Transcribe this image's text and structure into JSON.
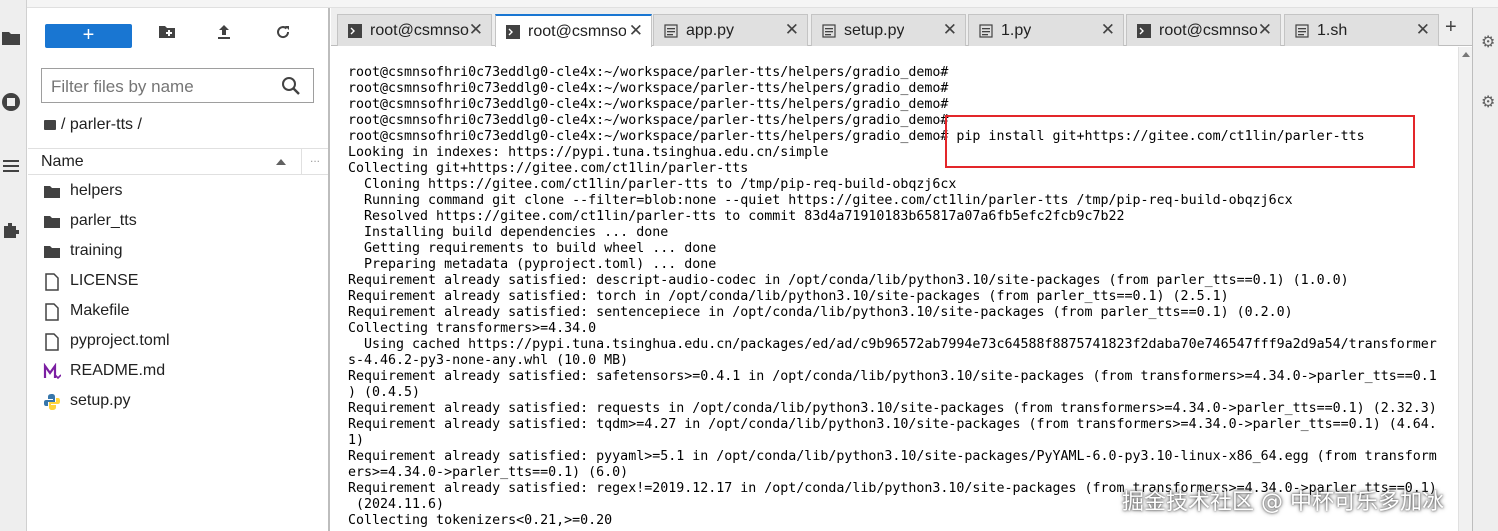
{
  "file_browser": {
    "new_button_label": "+",
    "filter_placeholder": "Filter files by name",
    "breadcrumb": "/ parler-tts /",
    "column_name": "Name",
    "more_columns": "...",
    "files": [
      {
        "name": "helpers",
        "icon": "folder-icon"
      },
      {
        "name": "parler_tts",
        "icon": "folder-icon"
      },
      {
        "name": "training",
        "icon": "folder-icon"
      },
      {
        "name": "LICENSE",
        "icon": "file-icon"
      },
      {
        "name": "Makefile",
        "icon": "file-icon"
      },
      {
        "name": "pyproject.toml",
        "icon": "file-icon"
      },
      {
        "name": "README.md",
        "icon": "markdown-icon"
      },
      {
        "name": "setup.py",
        "icon": "python-icon"
      }
    ]
  },
  "tabs": [
    {
      "label": "root@csmnso",
      "icon": "terminal-icon",
      "active": false
    },
    {
      "label": "root@csmnso",
      "icon": "terminal-icon",
      "active": true
    },
    {
      "label": "app.py",
      "icon": "editor-icon",
      "active": false
    },
    {
      "label": "setup.py",
      "icon": "editor-icon",
      "active": false
    },
    {
      "label": "1.py",
      "icon": "editor-icon",
      "active": false
    },
    {
      "label": "root@csmnso",
      "icon": "terminal-icon",
      "active": false
    },
    {
      "label": "1.sh",
      "icon": "editor-icon",
      "active": false
    }
  ],
  "new_tab_label": "+",
  "terminal": {
    "lines": [
      "root@csmnsofhri0c73eddlg0-cle4x:~/workspace/parler-tts/helpers/gradio_demo#",
      "root@csmnsofhri0c73eddlg0-cle4x:~/workspace/parler-tts/helpers/gradio_demo#",
      "root@csmnsofhri0c73eddlg0-cle4x:~/workspace/parler-tts/helpers/gradio_demo#",
      "root@csmnsofhri0c73eddlg0-cle4x:~/workspace/parler-tts/helpers/gradio_demo#",
      "root@csmnsofhri0c73eddlg0-cle4x:~/workspace/parler-tts/helpers/gradio_demo# pip install git+https://gitee.com/ct1lin/parler-tts",
      "Looking in indexes: https://pypi.tuna.tsinghua.edu.cn/simple",
      "Collecting git+https://gitee.com/ct1lin/parler-tts",
      "  Cloning https://gitee.com/ct1lin/parler-tts to /tmp/pip-req-build-obqzj6cx",
      "  Running command git clone --filter=blob:none --quiet https://gitee.com/ct1lin/parler-tts /tmp/pip-req-build-obqzj6cx",
      "  Resolved https://gitee.com/ct1lin/parler-tts to commit 83d4a71910183b65817a07a6fb5efc2fcb9c7b22",
      "  Installing build dependencies ... done",
      "  Getting requirements to build wheel ... done",
      "  Preparing metadata (pyproject.toml) ... done",
      "Requirement already satisfied: descript-audio-codec in /opt/conda/lib/python3.10/site-packages (from parler_tts==0.1) (1.0.0)",
      "Requirement already satisfied: torch in /opt/conda/lib/python3.10/site-packages (from parler_tts==0.1) (2.5.1)",
      "Requirement already satisfied: sentencepiece in /opt/conda/lib/python3.10/site-packages (from parler_tts==0.1) (0.2.0)",
      "Collecting transformers>=4.34.0",
      "  Using cached https://pypi.tuna.tsinghua.edu.cn/packages/ed/ad/c9b96572ab7994e73c64588f8875741823f2daba70e746547fff9a2d9a54/transformer",
      "s-4.46.2-py3-none-any.whl (10.0 MB)",
      "Requirement already satisfied: safetensors>=0.4.1 in /opt/conda/lib/python3.10/site-packages (from transformers>=4.34.0->parler_tts==0.1",
      ") (0.4.5)",
      "Requirement already satisfied: requests in /opt/conda/lib/python3.10/site-packages (from transformers>=4.34.0->parler_tts==0.1) (2.32.3)",
      "Requirement already satisfied: tqdm>=4.27 in /opt/conda/lib/python3.10/site-packages (from transformers>=4.34.0->parler_tts==0.1) (4.64.",
      "1)",
      "Requirement already satisfied: pyyaml>=5.1 in /opt/conda/lib/python3.10/site-packages/PyYAML-6.0-py3.10-linux-x86_64.egg (from transform",
      "ers>=4.34.0->parler_tts==0.1) (6.0)",
      "Requirement already satisfied: regex!=2019.12.17 in /opt/conda/lib/python3.10/site-packages (from transformers>=4.34.0->parler_tts==0.1)",
      " (2024.11.6)",
      "Collecting tokenizers<0.21,>=0.20"
    ]
  },
  "watermark": "掘金技术社区 @ 中杯可乐多加冰",
  "colors": {
    "accent": "#1976d2",
    "highlight_box": "#e3262a"
  }
}
